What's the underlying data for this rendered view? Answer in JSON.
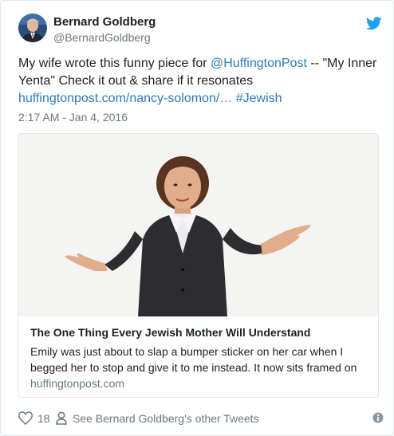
{
  "author": {
    "name": "Bernard Goldberg",
    "handle": "@BernardGoldberg"
  },
  "tweet": {
    "text_part1": "My wife wrote this funny piece for ",
    "mention": "@HuffingtonPost",
    "text_part2": " -- \"My Inner Yenta\" Check it out & share if it resonates ",
    "url": "huffingtonpost.com/nancy-solomon/…",
    "space": " ",
    "hashtag": "#Jewish",
    "timestamp": "2:17 AM - Jan 4, 2016"
  },
  "card": {
    "title": "The One Thing Every Jewish Mother Will Understand",
    "description": "Emily was just about to slap a bumper sticker on her car when I begged her to stop and give it to me instead. It now sits framed on",
    "domain": "huffingtonpost.com"
  },
  "actions": {
    "like_count": "18",
    "other_tweets": "See Bernard Goldberg's other Tweets"
  },
  "icons": {
    "brand": "twitter-bird-icon",
    "like": "heart-icon",
    "profile": "person-icon",
    "info": "info-icon"
  },
  "colors": {
    "link": "#2b7bb9",
    "twitter_blue": "#1da1f2",
    "secondary_text": "#697882",
    "border": "#e1e8ed"
  }
}
